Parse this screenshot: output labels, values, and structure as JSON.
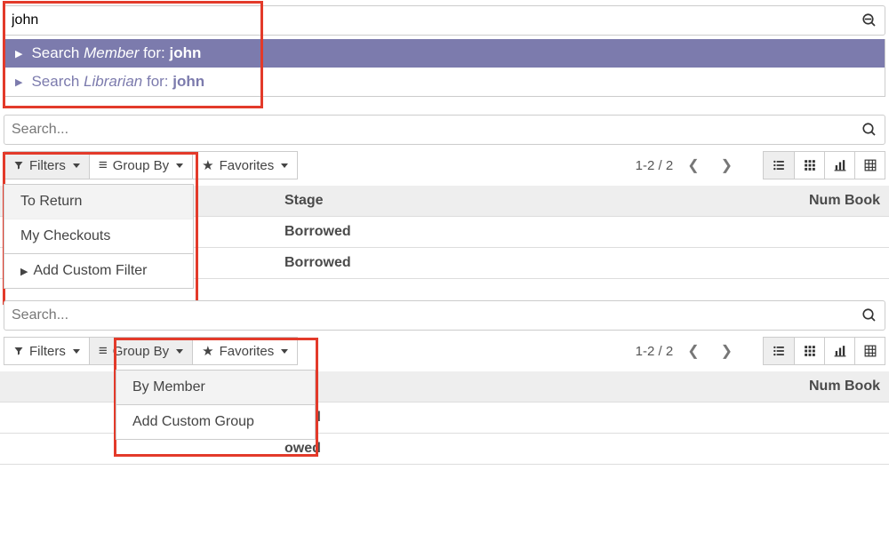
{
  "colors": {
    "accent": "#7c7bad",
    "annotation": "#e33a2a"
  },
  "search1": {
    "value": "john",
    "placeholder": "",
    "suggestions": [
      {
        "prefix": "Search",
        "entity": "Member",
        "for": "for:",
        "term": "john"
      },
      {
        "prefix": "Search",
        "entity": "Librarian",
        "for": "for:",
        "term": "john"
      }
    ]
  },
  "search2": {
    "value": "",
    "placeholder": "Search..."
  },
  "search3": {
    "value": "",
    "placeholder": "Search..."
  },
  "toolbar": {
    "filters": "Filters",
    "groupby": "Group By",
    "favorites": "Favorites",
    "pager": "1-2 / 2"
  },
  "filters_menu": {
    "items": [
      "To Return",
      "My Checkouts"
    ],
    "custom": "Add Custom Filter"
  },
  "groupby_menu": {
    "items": [
      "By Member"
    ],
    "custom": "Add Custom Group"
  },
  "table": {
    "headers": {
      "stage": "Stage",
      "num": "Num Book"
    },
    "rows": [
      {
        "stage": "Borrowed"
      },
      {
        "stage": "Borrowed"
      }
    ]
  }
}
